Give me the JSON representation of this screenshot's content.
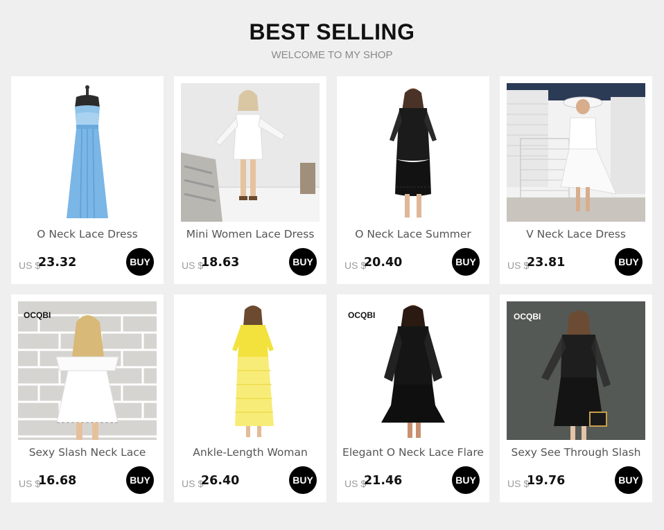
{
  "header": {
    "title": "BEST SELLING",
    "subtitle": "WELCOME TO MY SHOP"
  },
  "products": [
    {
      "name": "O Neck Lace Dress",
      "currency": "US $",
      "price": "23.32",
      "buy": "BUY",
      "brand": ""
    },
    {
      "name": "Mini Women Lace Dress",
      "currency": "US $",
      "price": "18.63",
      "buy": "BUY",
      "brand": ""
    },
    {
      "name": "O Neck Lace Summer",
      "currency": "US $",
      "price": "20.40",
      "buy": "BUY",
      "brand": ""
    },
    {
      "name": "V Neck Lace Dress",
      "currency": "US $",
      "price": "23.81",
      "buy": "BUY",
      "brand": ""
    },
    {
      "name": "Sexy Slash Neck Lace",
      "currency": "US $",
      "price": "16.68",
      "buy": "BUY",
      "brand": "OCQBI"
    },
    {
      "name": "Ankle-Length Woman",
      "currency": "US $",
      "price": "26.40",
      "buy": "BUY",
      "brand": ""
    },
    {
      "name": "Elegant O Neck Lace Flare",
      "currency": "US $",
      "price": "21.46",
      "buy": "BUY",
      "brand": "OCQBI"
    },
    {
      "name": "Sexy See Through Slash",
      "currency": "US $",
      "price": "19.76",
      "buy": "BUY",
      "brand": "OCQBI"
    }
  ]
}
